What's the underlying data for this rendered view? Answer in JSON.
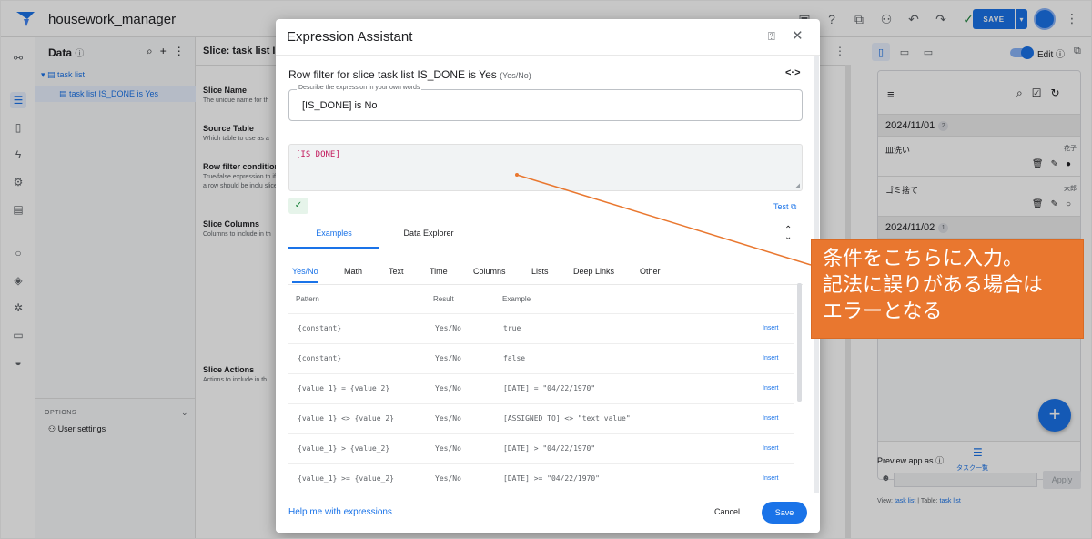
{
  "app": {
    "title": "housework_manager",
    "save_label": "SAVE"
  },
  "data_panel": {
    "title": "Data",
    "tree_root": "task list",
    "tree_child": "task list IS_DONE is Yes",
    "options_title": "OPTIONS",
    "user_settings": "User settings"
  },
  "slice_panel": {
    "title": "Slice: task list IS_",
    "fields": [
      {
        "label": "Slice Name",
        "desc": "The unique name for th"
      },
      {
        "label": "Source Table",
        "desc": "Which table to use as a"
      },
      {
        "label": "Row filter condition",
        "desc": "True/false expression th if a row should be inclu slice"
      },
      {
        "label": "Slice Columns",
        "desc": "Columns to include in th"
      },
      {
        "label": "Slice Actions",
        "desc": "Actions to include in th"
      }
    ]
  },
  "preview": {
    "edit_label": "Edit",
    "groups": [
      {
        "date": "2024/11/01",
        "count": "2"
      },
      {
        "date": "2024/11/02",
        "count": "1"
      }
    ],
    "rows": [
      {
        "name": "皿洗い",
        "who": "花子"
      },
      {
        "name": "ゴミ捨て",
        "who": "太郎"
      }
    ],
    "nav_label": "タスク一覧",
    "preview_as": "Preview app as",
    "apply": "Apply",
    "view_prefix": "View:",
    "view_name": "task list",
    "table_prefix": "Table:",
    "table_name": "task list"
  },
  "dialog": {
    "title": "Expression Assistant",
    "row_filter_label": "Row filter for slice task list IS_DONE is Yes",
    "row_filter_type": "(Yes/No)",
    "describe_legend": "Describe the expression in your own words",
    "describe_value": "[IS_DONE] is No",
    "expression": "[IS_DONE]",
    "test_label": "Test",
    "tabs": [
      "Examples",
      "Data Explorer"
    ],
    "categories": [
      "Yes/No",
      "Math",
      "Text",
      "Time",
      "Columns",
      "Lists",
      "Deep Links",
      "Other"
    ],
    "table_headers": [
      "Pattern",
      "Result",
      "Example"
    ],
    "rows": [
      {
        "pattern": "{constant}",
        "result": "Yes/No",
        "example": "true",
        "action": "Insert"
      },
      {
        "pattern": "{constant}",
        "result": "Yes/No",
        "example": "false",
        "action": "Insert"
      },
      {
        "pattern": "{value_1} = {value_2}",
        "result": "Yes/No",
        "example": "[DATE] = \"04/22/1970\"",
        "action": "Insert"
      },
      {
        "pattern": "{value_1} <> {value_2}",
        "result": "Yes/No",
        "example": "[ASSIGNED_TO] <> \"text value\"",
        "action": "Insert"
      },
      {
        "pattern": "{value_1} > {value_2}",
        "result": "Yes/No",
        "example": "[DATE] > \"04/22/1970\"",
        "action": "Insert"
      },
      {
        "pattern": "{value_1} >= {value_2}",
        "result": "Yes/No",
        "example": "[DATE] >= \"04/22/1970\"",
        "action": "Insert"
      }
    ],
    "help_link": "Help me with expressions",
    "cancel": "Cancel",
    "save": "Save"
  },
  "annotation": {
    "lines": [
      "条件をこちらに入力。",
      "記法に誤りがある場合は",
      "エラーとなる"
    ],
    "color": "#e9772f"
  },
  "colors": {
    "accent": "#1a73e8",
    "expression_text": "#c2185b",
    "valid": "#188038"
  }
}
